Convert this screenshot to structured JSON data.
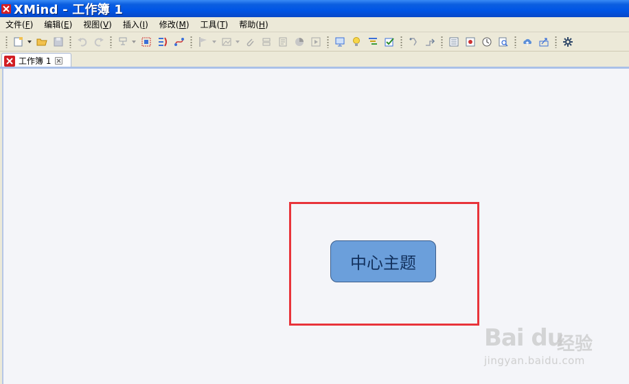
{
  "window": {
    "title": "XMind - 工作簿 1"
  },
  "menu": [
    {
      "label": "文件(",
      "key": "F",
      "suffix": ")"
    },
    {
      "label": "编辑(",
      "key": "E",
      "suffix": ")"
    },
    {
      "label": "视图(",
      "key": "V",
      "suffix": ")"
    },
    {
      "label": "插入(",
      "key": "I",
      "suffix": ")"
    },
    {
      "label": "修改(",
      "key": "M",
      "suffix": ")"
    },
    {
      "label": "工具(",
      "key": "T",
      "suffix": ")"
    },
    {
      "label": "帮助(",
      "key": "H",
      "suffix": ")"
    }
  ],
  "tab": {
    "label": "工作簿 1"
  },
  "map": {
    "central_topic": "中心主题"
  },
  "watermark": {
    "brand": "Bai  du",
    "product": "经验",
    "url": "jingyan.baidu.com"
  },
  "colors": {
    "title_bar": "#0055e5",
    "topic_fill": "#6b9fdb",
    "highlight": "#e8333a"
  }
}
